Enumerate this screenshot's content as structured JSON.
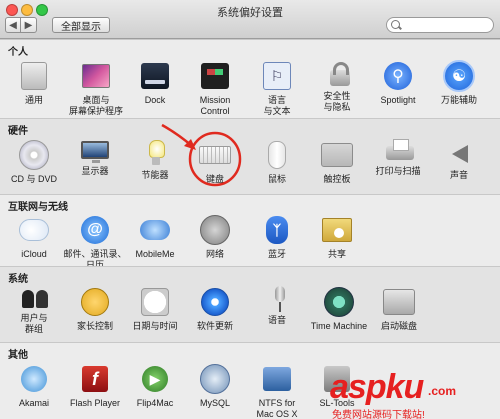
{
  "window": {
    "title": "系统偏好设置",
    "show_all_label": "全部显示",
    "search_placeholder": "",
    "colors": {
      "close": "#fc5753",
      "minimize": "#fdbc40",
      "zoom": "#33c748"
    }
  },
  "sections": [
    {
      "title": "个人",
      "items": [
        {
          "label": "通用",
          "icon": "general-icon"
        },
        {
          "label": "桌面与\n屏幕保护程序",
          "icon": "desktop-icon"
        },
        {
          "label": "Dock",
          "icon": "dock-icon"
        },
        {
          "label": "Mission\nControl",
          "icon": "mission-control-icon"
        },
        {
          "label": "语言\n与文本",
          "icon": "language-icon"
        },
        {
          "label": "安全性\n与隐私",
          "icon": "security-icon"
        },
        {
          "label": "Spotlight",
          "icon": "spotlight-icon"
        },
        {
          "label": "万能辅助",
          "icon": "accessibility-icon"
        }
      ]
    },
    {
      "title": "硬件",
      "items": [
        {
          "label": "CD 与 DVD",
          "icon": "cd-icon"
        },
        {
          "label": "显示器",
          "icon": "display-icon"
        },
        {
          "label": "节能器",
          "icon": "energy-saver-icon"
        },
        {
          "label": "键盘",
          "icon": "keyboard-icon"
        },
        {
          "label": "鼠标",
          "icon": "mouse-icon"
        },
        {
          "label": "触控板",
          "icon": "trackpad-icon"
        },
        {
          "label": "打印与扫描",
          "icon": "printer-icon"
        },
        {
          "label": "声音",
          "icon": "sound-icon"
        }
      ]
    },
    {
      "title": "互联网与无线",
      "items": [
        {
          "label": "iCloud",
          "icon": "icloud-icon"
        },
        {
          "label": "邮件、通讯录、\n日历",
          "icon": "mail-icon"
        },
        {
          "label": "MobileMe",
          "icon": "mobileme-icon"
        },
        {
          "label": "网络",
          "icon": "network-icon"
        },
        {
          "label": "蓝牙",
          "icon": "bluetooth-icon"
        },
        {
          "label": "共享",
          "icon": "sharing-icon"
        }
      ]
    },
    {
      "title": "系统",
      "items": [
        {
          "label": "用户与\n群组",
          "icon": "users-icon"
        },
        {
          "label": "家长控制",
          "icon": "parental-controls-icon"
        },
        {
          "label": "日期与时间",
          "icon": "date-time-icon"
        },
        {
          "label": "软件更新",
          "icon": "software-update-icon"
        },
        {
          "label": "语音",
          "icon": "speech-icon"
        },
        {
          "label": "Time Machine",
          "icon": "time-machine-icon"
        },
        {
          "label": "启动磁盘",
          "icon": "startup-disk-icon"
        }
      ]
    },
    {
      "title": "其他",
      "items": [
        {
          "label": "Akamai",
          "icon": "akamai-icon"
        },
        {
          "label": "Flash Player",
          "icon": "flash-icon"
        },
        {
          "label": "Flip4Mac",
          "icon": "flip4mac-icon"
        },
        {
          "label": "MySQL",
          "icon": "mysql-icon"
        },
        {
          "label": "NTFS for\nMac OS X",
          "icon": "ntfs-icon"
        },
        {
          "label": "SL-Tools",
          "icon": "sl-tools-icon"
        }
      ]
    }
  ],
  "watermark": {
    "brand": "aspku",
    "domain": ".com",
    "tagline": "免费网站源码下载站!",
    "color": "#e62020"
  },
  "annotation": {
    "color": "#e02a1f"
  }
}
